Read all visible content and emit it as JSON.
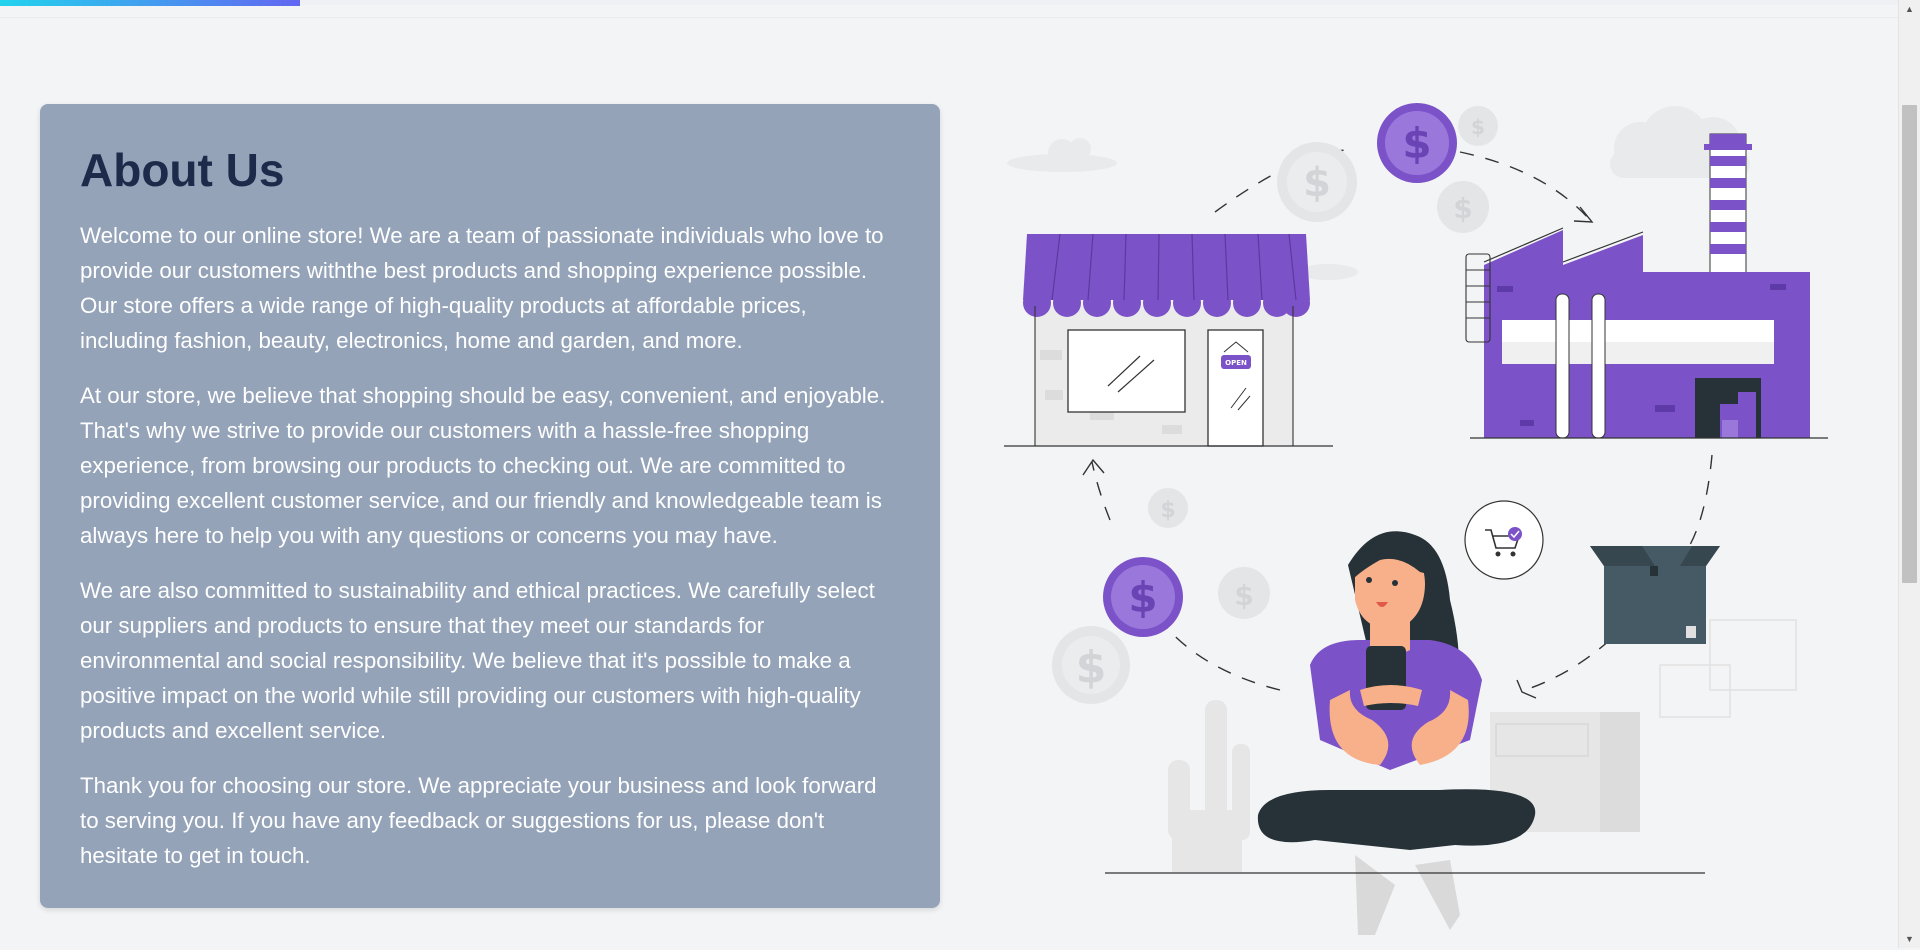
{
  "page": {
    "progress": 0.158
  },
  "about": {
    "title": "About Us",
    "paragraphs": [
      "Welcome to our online store! We are a team of passionate individuals who love to provide our customers withthe best products and shopping experience possible. Our store offers a wide range of high-quality products at affordable prices, including fashion, beauty, electronics, home and garden, and more.",
      "At our store, we believe that shopping should be easy, convenient, and enjoyable. That's why we strive to provide our customers with a hassle-free shopping experience, from browsing our products to checking out. We are committed to providing excellent customer service, and our friendly and knowledgeable team is always here to help you with any questions or concerns you may have.",
      "We are also committed to sustainability and ethical practices. We carefully select our suppliers and products to ensure that they meet our standards for environmental and social responsibility. We believe that it's possible to make a positive impact on the world while still providing our customers with high-quality products and excellent service.",
      "Thank you for choosing our store. We appreciate your business and look forward to serving you. If you have any feedback or suggestions for us, please don't hesitate to get in touch."
    ]
  },
  "illustration": {
    "store_sign": "OPEN",
    "currency_symbol": "$"
  },
  "colors": {
    "accent": "#7c52c9",
    "card_bg": "#94a3b8",
    "title": "#1e2a4a",
    "page_bg": "#f3f4f6",
    "progress_start": "#22d3ee",
    "progress_end": "#6366f1"
  }
}
